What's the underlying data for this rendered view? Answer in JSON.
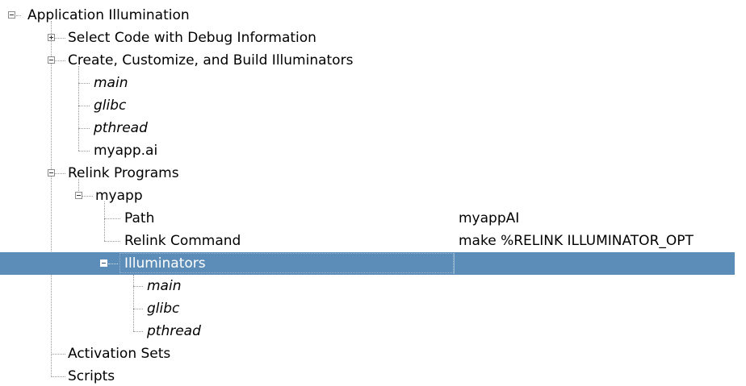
{
  "tree": {
    "root_label": "Application Illumination",
    "select_code_label": "Select Code with Debug Information",
    "create_label": "Create, Customize, and Build Illuminators",
    "create_children": [
      "main",
      "glibc",
      "pthread",
      "myapp.ai"
    ],
    "relink_label": "Relink Programs",
    "myapp_label": "myapp",
    "path_label": "Path",
    "path_value": "myappAI",
    "relink_command_label": "Relink Command",
    "relink_command_value": "make %RELINK ILLUMINATOR_OPT",
    "illuminators_label": "Illuminators",
    "illuminators_children": [
      "main",
      "glibc",
      "pthread"
    ],
    "activation_sets_label": "Activation Sets",
    "scripts_label": "Scripts"
  },
  "colors": {
    "selection_background": "#5b8db8",
    "selection_text": "#ffffff",
    "connector_line": "#9a9a9a"
  }
}
